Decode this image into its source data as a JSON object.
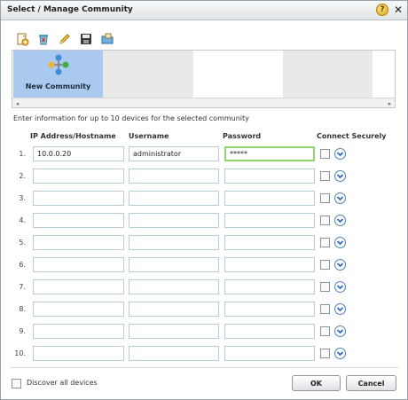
{
  "window": {
    "title": "Select / Manage Community",
    "help_label": "?",
    "close_label": "✕"
  },
  "toolbar": {
    "icons": [
      "new-community-icon",
      "delete-icon",
      "edit-icon",
      "save-icon",
      "open-icon"
    ]
  },
  "communities": {
    "selected_label": "New Community",
    "scroll_left": "◂",
    "scroll_right": "▸"
  },
  "instructions": "Enter information for up to 10 devices for the selected community",
  "columns": {
    "ip": "IP Address/Hostname",
    "username": "Username",
    "password": "Password",
    "secure": "Connect Securely"
  },
  "devices": [
    {
      "num": "1.",
      "ip": "10.0.0.20",
      "username": "administrator",
      "password": "*****",
      "secure": false
    },
    {
      "num": "2.",
      "ip": "",
      "username": "",
      "password": "",
      "secure": false
    },
    {
      "num": "3.",
      "ip": "",
      "username": "",
      "password": "",
      "secure": false
    },
    {
      "num": "4.",
      "ip": "",
      "username": "",
      "password": "",
      "secure": false
    },
    {
      "num": "5.",
      "ip": "",
      "username": "",
      "password": "",
      "secure": false
    },
    {
      "num": "6.",
      "ip": "",
      "username": "",
      "password": "",
      "secure": false
    },
    {
      "num": "7.",
      "ip": "",
      "username": "",
      "password": "",
      "secure": false
    },
    {
      "num": "8.",
      "ip": "",
      "username": "",
      "password": "",
      "secure": false
    },
    {
      "num": "9.",
      "ip": "",
      "username": "",
      "password": "",
      "secure": false
    },
    {
      "num": "10.",
      "ip": "",
      "username": "",
      "password": "",
      "secure": false
    }
  ],
  "footer": {
    "discover_label": "Discover all devices",
    "ok_label": "OK",
    "cancel_label": "Cancel"
  },
  "colors": {
    "selected_tile": "#a9c9ee",
    "focus_border": "#8fd66a",
    "verify_accent": "#2f6db5"
  }
}
